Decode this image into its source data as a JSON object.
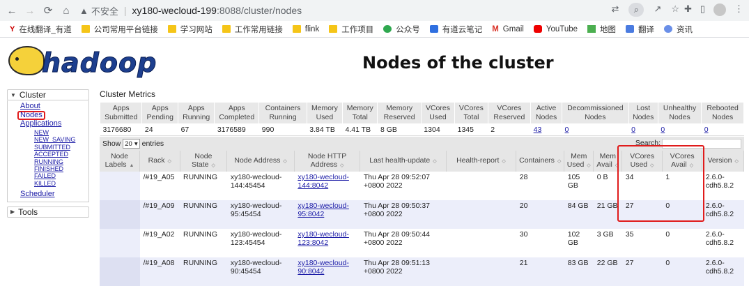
{
  "browser": {
    "security_label": "不安全",
    "url_host": "xy180-wecloud-199",
    "url_path": ":8088/cluster/nodes",
    "bookmarks": [
      "在线翻译_有道",
      "公司常用平台链接",
      "学习网站",
      "工作常用链接",
      "flink",
      "工作项目",
      "公众号",
      "有道云笔记",
      "Gmail",
      "YouTube",
      "地图",
      "翻译",
      "资讯"
    ]
  },
  "page": {
    "logo_text": "hadoop",
    "title": "Nodes of the cluster"
  },
  "sidebar": {
    "cluster_label": "Cluster",
    "links": [
      "About",
      "Nodes",
      "Applications"
    ],
    "app_states": [
      "NEW",
      "NEW_SAVING",
      "SUBMITTED",
      "ACCEPTED",
      "RUNNING",
      "FINISHED",
      "FAILED",
      "KILLED"
    ],
    "scheduler_label": "Scheduler",
    "tools_label": "Tools"
  },
  "cluster_metrics": {
    "title": "Cluster Metrics",
    "headers": [
      "Apps Submitted",
      "Apps Pending",
      "Apps Running",
      "Apps Completed",
      "Containers Running",
      "Memory Used",
      "Memory Total",
      "Memory Reserved",
      "VCores Used",
      "VCores Total",
      "VCores Reserved",
      "Active Nodes",
      "Decommissioned Nodes",
      "Lost Nodes",
      "Unhealthy Nodes",
      "Rebooted Nodes"
    ],
    "values": [
      "3176680",
      "24",
      "67",
      "3176589",
      "990",
      "3.84 TB",
      "4.41 TB",
      "8 GB",
      "1304",
      "1345",
      "2",
      "43",
      "0",
      "0",
      "0",
      "0"
    ]
  },
  "controls": {
    "show_label": "Show",
    "page_size": "20",
    "entries_label": "entries",
    "search_label": "Search:"
  },
  "nodes_table": {
    "headers": [
      "Node Labels",
      "Rack",
      "Node State",
      "Node Address",
      "Node HTTP Address",
      "Last health-update",
      "Health-report",
      "Containers",
      "Mem Used",
      "Mem Avail",
      "VCores Used",
      "VCores Avail",
      "Version"
    ],
    "rows": [
      {
        "labels": "",
        "rack": "/#19_A05",
        "state": "RUNNING",
        "address": "xy180-wecloud-144:45454",
        "http": "xy180-wecloud-144:8042",
        "health_update": "Thu Apr 28 09:52:07 +0800 2022",
        "health_report": "",
        "containers": "28",
        "mem_used": "105 GB",
        "mem_avail": "0 B",
        "vcores_used": "34",
        "vcores_avail": "1",
        "version": "2.6.0-cdh5.8.2"
      },
      {
        "labels": "",
        "rack": "/#19_A09",
        "state": "RUNNING",
        "address": "xy180-wecloud-95:45454",
        "http": "xy180-wecloud-95:8042",
        "health_update": "Thu Apr 28 09:50:37 +0800 2022",
        "health_report": "",
        "containers": "20",
        "mem_used": "84 GB",
        "mem_avail": "21 GB",
        "vcores_used": "27",
        "vcores_avail": "0",
        "version": "2.6.0-cdh5.8.2"
      },
      {
        "labels": "",
        "rack": "/#19_A02",
        "state": "RUNNING",
        "address": "xy180-wecloud-123:45454",
        "http": "xy180-wecloud-123:8042",
        "health_update": "Thu Apr 28 09:50:44 +0800 2022",
        "health_report": "",
        "containers": "30",
        "mem_used": "102 GB",
        "mem_avail": "3 GB",
        "vcores_used": "35",
        "vcores_avail": "0",
        "version": "2.6.0-cdh5.8.2"
      },
      {
        "labels": "",
        "rack": "/#19_A08",
        "state": "RUNNING",
        "address": "xy180-wecloud-90:45454",
        "http": "xy180-wecloud-90:8042",
        "health_update": "Thu Apr 28 09:51:13 +0800 2022",
        "health_report": "",
        "containers": "21",
        "mem_used": "83 GB",
        "mem_avail": "22 GB",
        "vcores_used": "27",
        "vcores_avail": "0",
        "version": "2.6.0-cdh5.8.2"
      }
    ]
  }
}
